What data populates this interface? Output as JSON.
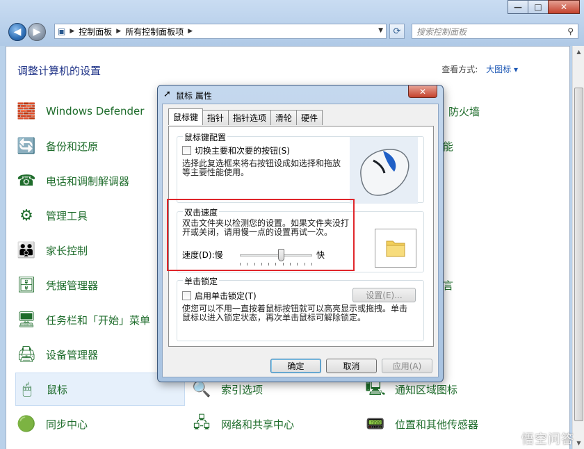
{
  "titlebar": {
    "minimize": "—",
    "maximize": "□",
    "close": "✕"
  },
  "nav": {
    "back": "◀",
    "forward": "▶"
  },
  "address": {
    "crumbs": [
      "控制面板",
      "所有控制面板项"
    ]
  },
  "search": {
    "placeholder": "搜索控制面板"
  },
  "page": {
    "heading": "调整计算机的设置",
    "view_by_label": "查看方式:",
    "view_by_value": "大图标"
  },
  "items": [
    {
      "label": "Windows Defender",
      "icon": "defender-wall-icon"
    },
    {
      "label": "备份和还原",
      "icon": "backup-icon"
    },
    {
      "label": "电话和调制解调器",
      "icon": "phone-icon"
    },
    {
      "label": "管理工具",
      "icon": "admin-tools-icon"
    },
    {
      "label": "家长控制",
      "icon": "parental-icon"
    },
    {
      "label": "凭据管理器",
      "icon": "credential-icon"
    },
    {
      "label": "任务栏和「开始」菜单",
      "icon": "taskbar-icon"
    },
    {
      "label": "设备管理器",
      "icon": "device-manager-icon"
    },
    {
      "label": "鼠标",
      "icon": "mouse-icon"
    },
    {
      "label": "同步中心",
      "icon": "sync-icon"
    },
    {
      "label": "索引选项",
      "icon": "index-icon"
    },
    {
      "label": "网络和共享中心",
      "icon": "network-icon"
    },
    {
      "label": "通知区域图标",
      "icon": "notification-icon"
    },
    {
      "label": "位置和其他传感器",
      "icon": "sensor-icon"
    },
    {
      "label": "防火墙",
      "icon": "firewall-icon"
    },
    {
      "label": "能",
      "icon": ""
    },
    {
      "label": "言",
      "icon": ""
    }
  ],
  "dialog": {
    "title": "鼠标 属性",
    "tabs": [
      "鼠标键",
      "指针",
      "指针选项",
      "滑轮",
      "硬件"
    ],
    "button_config": {
      "label": "鼠标键配置",
      "checkbox": "切换主要和次要的按钮(S)",
      "desc": "选择此复选框来将右按钮设成如选择和拖放等主要性能使用。"
    },
    "double_click": {
      "label": "双击速度",
      "desc": "双击文件夹以检测您的设置。如果文件夹没打开或关闭，请用慢一点的设置再试一次。",
      "speed_label": "速度(D):慢",
      "fast_label": "快",
      "speed_value": 0.6
    },
    "click_lock": {
      "label": "单击锁定",
      "checkbox": "启用单击锁定(T)",
      "settings_button": "设置(E)...",
      "desc": "使您可以不用一直按着鼠标按钮就可以高亮显示或拖拽。单击鼠标以进入锁定状态，再次单击鼠标可解除锁定。"
    },
    "ok": "确定",
    "cancel": "取消",
    "apply": "应用(A)"
  },
  "watermark": "悟空问答"
}
